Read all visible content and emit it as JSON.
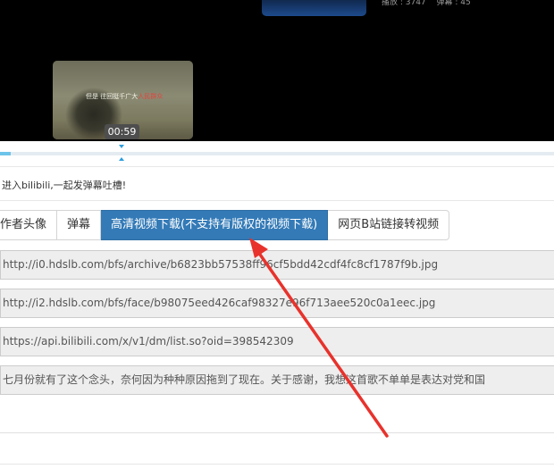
{
  "player": {
    "stats": {
      "plays": "播放 : 3747",
      "danmaku": "弹幕 : 45"
    },
    "preview": {
      "subtitle_prefix": "但是 往回挺千广大",
      "subtitle_highlight": "人民群众"
    },
    "time": "00:59",
    "progress_fraction": 0.02
  },
  "danmaku_bar": {
    "text": "进入bilibili,一起发弹幕吐槽!"
  },
  "tabs": [
    {
      "label": "作者头像",
      "active": false
    },
    {
      "label": "弹幕",
      "active": false
    },
    {
      "label": "高清视频下载(不支持有版权的视频下载)",
      "active": true
    },
    {
      "label": "网页B站链接转视频",
      "active": false
    }
  ],
  "fields": {
    "cover_url": "http://i0.hdslb.com/bfs/archive/b6823bb57538ff96cf5bdd42cdf4fc8cf1787f9b.jpg",
    "face_url": "http://i2.hdslb.com/bfs/face/b98075eed426caf98327e96f713aee520c0a1eec.jpg",
    "danmaku_api": "https://api.bilibili.com/x/v1/dm/list.so?oid=398542309",
    "description": "七月份就有了这个念头，奈何因为种种原因拖到了现在。关于感谢，我想这首歌不单单是表达对党和国"
  },
  "colors": {
    "active_tab": "#337ab7",
    "arrow": "#e8322c",
    "progress": "#6dc4ea"
  }
}
